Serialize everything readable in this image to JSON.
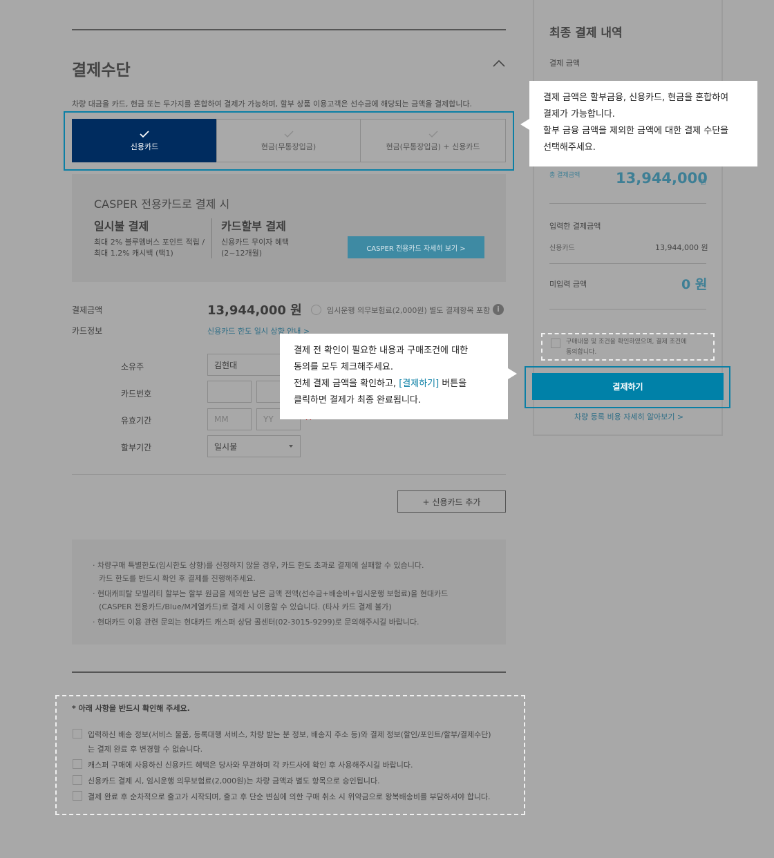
{
  "payment_method": {
    "title": "결제수단",
    "description": "차량 대금을 카드, 현금 또는 두가지를 혼합하여 결제가 가능하며, 할부 상품 이용고객은 선수금에 해당되는 금액을 결제합니다.",
    "tabs": [
      {
        "label": "신용카드",
        "active": true
      },
      {
        "label": "현금(무통장입금)",
        "active": false
      },
      {
        "label": "현금(무통장입금) + 신용카드",
        "active": false
      }
    ]
  },
  "promo": {
    "title": "CASPER 전용카드로 결제 시",
    "lump_title": "일시불 결제",
    "lump_desc_1": "최대 2% 블루멤버스 포인트 적립 /",
    "lump_desc_2": "최대 1.2% 캐시백 (택1)",
    "install_title": "카드할부 결제",
    "install_desc_1": "신용카드 무이자 혜택",
    "install_desc_2": "(2~12개월)",
    "button": "CASPER 전용카드 자세히 보기 >"
  },
  "payment": {
    "amount_label": "결제금액",
    "amount_value": "13,944,000 원",
    "insurance_option": "임시운행 의무보험료(2,000원) 별도 결제항목 포함",
    "card_info_label": "카드정보",
    "card_limit_link": "신용카드 한도 일시 상향 안내 >"
  },
  "card_form": {
    "owner_label": "소유주",
    "owner_value": "김현대",
    "number_label": "카드번호",
    "expiry_label": "유효기간",
    "month_placeholder": "MM",
    "year_placeholder": "YY",
    "installment_label": "할부기간",
    "installment_value": "일시불",
    "add_card_button": "+ 신용카드 추가"
  },
  "notices": [
    "·  차량구매 특별한도(임시한도 상향)를 신청하지 않을 경우, 카드 한도 초과로 결제에 실패할 수 있습니다.",
    "카드 한도를 반드시 확인 후 결제를 진행해주세요.",
    "·  현대캐피탈 모빌리티 할부는 할부 원금을 제외한 남은 금액 전액(선수금+배송비+임시운행 보험료)을 현대카드",
    "(CASPER 전용카드/Blue/M계열카드)로 결제 시 이용할 수 있습니다. (타사 카드 결제 불가)",
    "·  현대카드 이용 관련 문의는 현대카드 캐스퍼 상담 콜센터(02-3015-9299)로 문의해주시길 바랍니다."
  ],
  "confirm": {
    "title": "* 아래 사항을 반드시 확인해 주세요.",
    "items": [
      "입력하신 배송 정보(서비스 물품, 등록대행 서비스, 차량 받는 분 정보, 배송지 주소 등)와 결제 정보(할인/포인트/할부/결제수단)",
      "는 결제 완료 후 변경할 수 없습니다.",
      "캐스퍼 구매에 사용하신 신용카드 혜택은 당사와 무관하며 각 카드사에 확인 후 사용해주시길 바랍니다.",
      "신용카드 결제 시, 임시운행 의무보험료(2,000원)는 차량 금액과 별도 항목으로 승인됩니다.",
      "결제 완료 후 순차적으로 출고가 시작되며, 출고 후 단순 변심에 의한 구매 취소 시 위약금으로 왕복배송비를 부담하셔야 합니다."
    ]
  },
  "summary": {
    "title": "최종 결제 내역",
    "amount_label": "결제 금액",
    "total_label": "총 결제금액",
    "total_value": "13,944,000",
    "won": "원",
    "entered_label": "입력한 결제금액",
    "card_label": "신용카드",
    "card_value": "13,944,000 원",
    "remaining_label": "미입력 금액",
    "remaining_value": "0 원",
    "agree_line_1": "구매내용 및 조건을 확인하였으며, 결제 조건에",
    "agree_line_2": "동의합니다.",
    "pay_button": "결제하기",
    "reg_link": "차량 등록 비용 자세히 알아보기 >"
  },
  "tooltip1": {
    "line1": "결제 금액은 할부금융, 신용카드, 현금을 혼합하여",
    "line2": "결제가 가능합니다.",
    "line3": "할부 금융 금액을 제외한 금액에 대한 결제 수단을",
    "line4": "선택해주세요."
  },
  "tooltip2": {
    "line1": "결제 전 확인이 필요한 내용과 구매조건에 대한",
    "line2": "동의를 모두 체크해주세요.",
    "line3_pre": "전체 결제 금액을 확인하고, ",
    "line3_link": "[결제하기]",
    "line3_post": " 버튼을",
    "line4": "클릭하면 결제가 최종 완료됩니다."
  },
  "colors": {
    "overlay_bg": "#a8a8a8",
    "active_tab": "#002c5f",
    "pay_button": "#0081a8",
    "highlight": "#0b7fa5"
  }
}
